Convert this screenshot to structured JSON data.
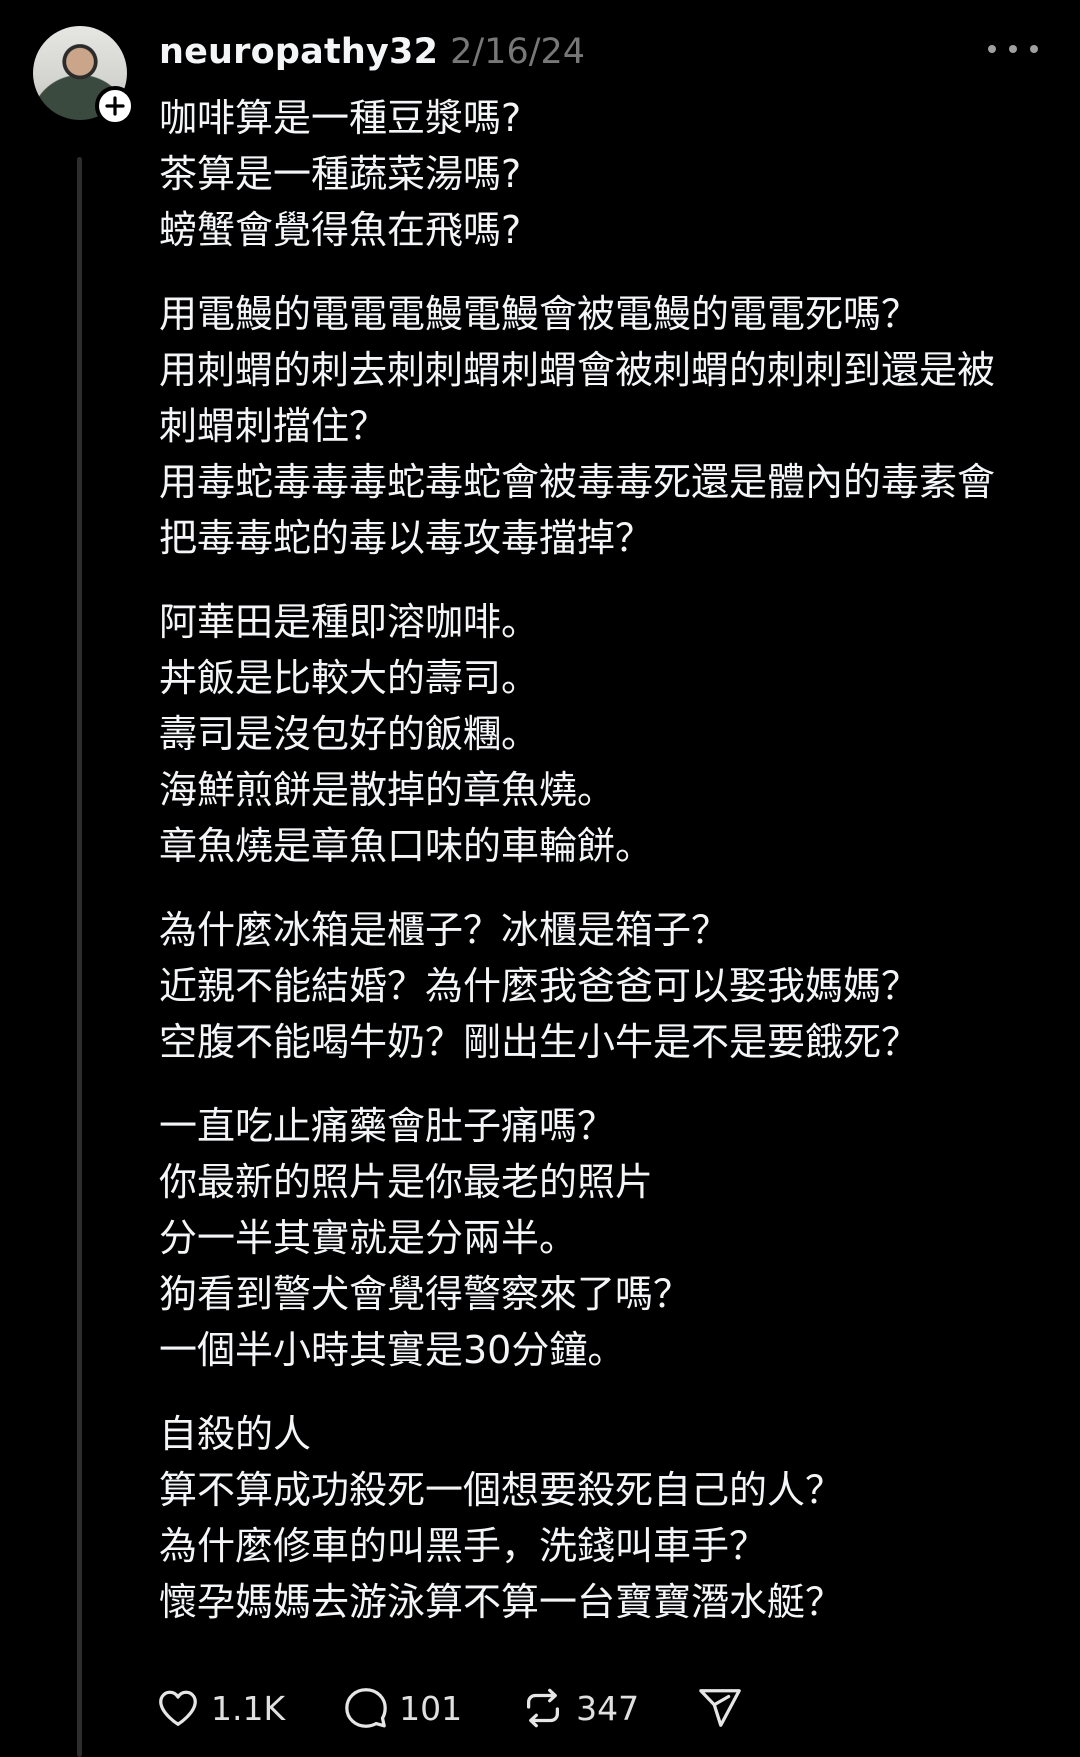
{
  "post": {
    "username": "neuropathy32",
    "timestamp": "2/16/24",
    "paragraphs": [
      [
        "咖啡算是一種豆漿嗎?",
        "茶算是一種蔬菜湯嗎?",
        "螃蟹會覺得魚在飛嗎?"
      ],
      [
        "用電鰻的電電電鰻電鰻會被電鰻的電電死嗎？",
        "用刺蝟的刺去刺刺蝟刺蝟會被刺蝟的刺刺到還是被",
        "刺蝟刺擋住？",
        "用毒蛇毒毒毒蛇毒蛇會被毒毒死還是體內的毒素會",
        "把毒毒蛇的毒以毒攻毒擋掉？"
      ],
      [
        "阿華田是種即溶咖啡。",
        "丼飯是比較大的壽司。",
        "壽司是沒包好的飯糰。",
        "海鮮煎餅是散掉的章魚燒。",
        "章魚燒是章魚口味的車輪餅。"
      ],
      [
        "為什麼冰箱是櫃子？冰櫃是箱子？",
        "近親不能結婚？為什麼我爸爸可以娶我媽媽？",
        "空腹不能喝牛奶？剛出生小牛是不是要餓死？"
      ],
      [
        "一直吃止痛藥會肚子痛嗎？",
        "你最新的照片是你最老的照片",
        "分一半其實就是分兩半。",
        "狗看到警犬會覺得警察來了嗎？",
        "一個半小時其實是30分鐘。"
      ],
      [
        "自殺的人",
        "算不算成功殺死一個想要殺死自己的人？",
        "為什麼修車的叫黑手，洗錢叫車手？",
        "懷孕媽媽去游泳算不算一台寶寶潛水艇？"
      ]
    ]
  },
  "actions": {
    "likes": "1.1K",
    "replies": "101",
    "reposts": "347"
  },
  "icons": {
    "like": "heart-icon",
    "reply": "speech-bubble-icon",
    "repost": "repost-icon",
    "share": "send-icon",
    "more": "more-icon",
    "follow": "plus-icon"
  },
  "colors": {
    "background": "#000000",
    "text": "#f3f5f7",
    "muted": "#777777",
    "thread_line": "#2d2d2d"
  }
}
